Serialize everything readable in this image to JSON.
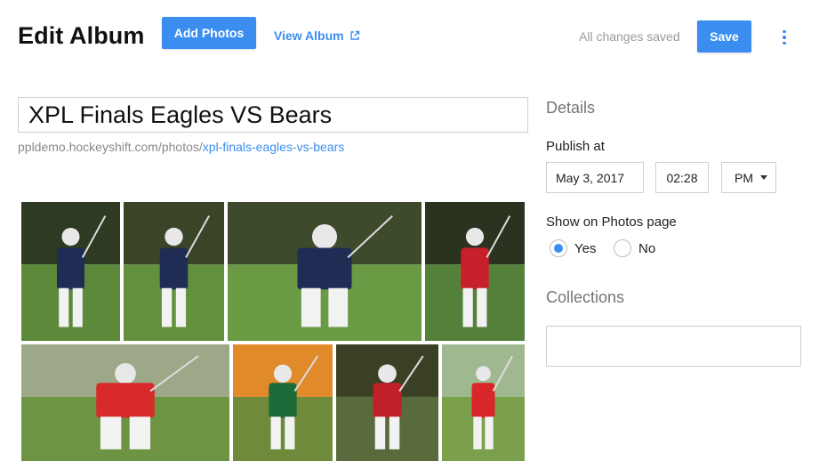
{
  "header": {
    "title": "Edit Album",
    "add_photos_label": "Add Photos",
    "view_album_label": "View Album",
    "status_text": "All changes saved",
    "save_label": "Save"
  },
  "album": {
    "title_value": "XPL Finals Eagles VS Bears",
    "url_base": "ppldemo.hockeyshift.com/photos/",
    "url_slug": "xpl-finals-eagles-vs-bears"
  },
  "details": {
    "heading": "Details",
    "publish_label": "Publish at",
    "date": "May 3, 2017",
    "time": "02:28",
    "ampm": "PM",
    "show_label": "Show on Photos page",
    "yes_label": "Yes",
    "no_label": "No",
    "show_selected": "Yes",
    "collections_heading": "Collections",
    "collections_value": ""
  },
  "photos": [
    {
      "subject": "lacrosse-player-navy-running",
      "ground": "#5d8a3a",
      "sky": "#2f3a22",
      "jersey": "#1f2d55"
    },
    {
      "subject": "lacrosse-players-navy-cradling",
      "ground": "#62903c",
      "sky": "#3a4528",
      "jersey": "#1f2d55"
    },
    {
      "subject": "lacrosse-players-navy-vs-white",
      "ground": "#6a9a44",
      "sky": "#3e4a2c",
      "jersey": "#1f2d55"
    },
    {
      "subject": "lacrosse-team-red-celebrating",
      "ground": "#55803a",
      "sky": "#2a3320",
      "jersey": "#c8202a"
    },
    {
      "subject": "lacrosse-red-player-checking",
      "ground": "#6c9442",
      "sky": "#9da889",
      "jersey": "#d82a2a"
    },
    {
      "subject": "lacrosse-green-player-stick",
      "ground": "#6e8a3a",
      "sky": "#e08a2a",
      "jersey": "#1e6b3a"
    },
    {
      "subject": "lacrosse-red-helmet-faceoff",
      "ground": "#596a3c",
      "sky": "#3a4024",
      "jersey": "#c02028"
    },
    {
      "subject": "lacrosse-youth-red-player",
      "ground": "#7aa04c",
      "sky": "#a0b890",
      "jersey": "#d8262a"
    }
  ],
  "colors": {
    "accent": "#3b8ef0",
    "muted_text": "#9a9a9a",
    "border": "#cfcfcf"
  }
}
